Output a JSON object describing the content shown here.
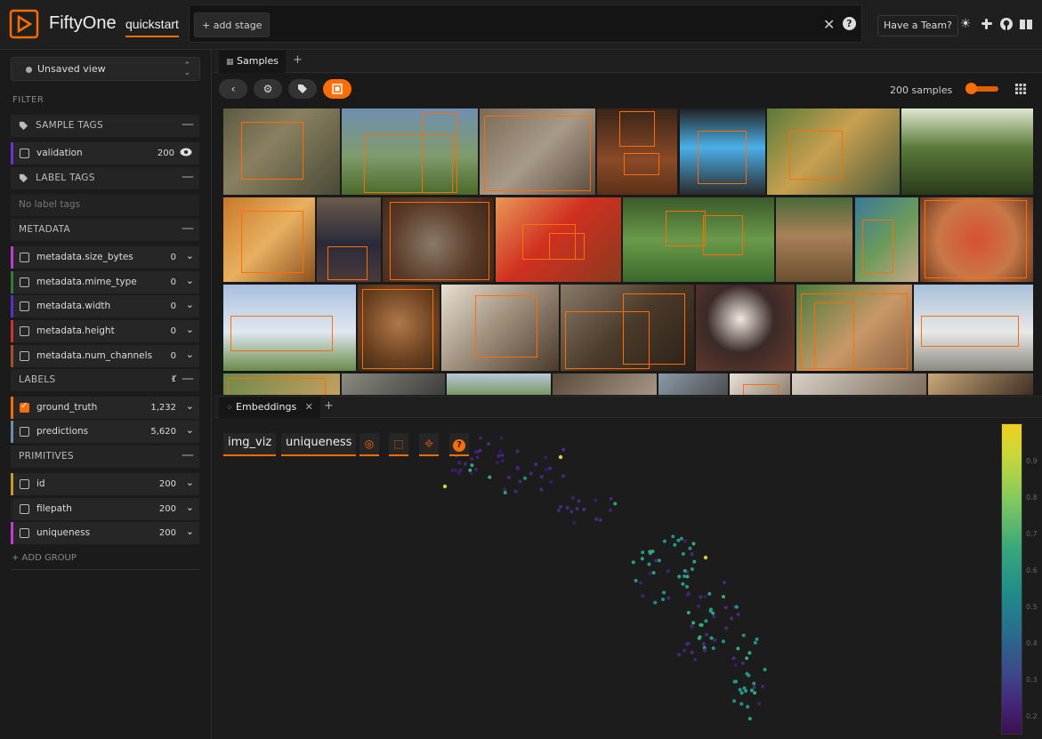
{
  "app": {
    "brand": "FiftyOne",
    "dataset": "quickstart"
  },
  "header": {
    "add_stage": "+ add stage",
    "team_button": "Have a Team?"
  },
  "sidebar": {
    "view_select": "Unsaved view",
    "filter_title": "FILTER",
    "sample_tags_title": "SAMPLE TAGS",
    "label_tags_title": "LABEL TAGS",
    "no_label_tags": "No label tags",
    "metadata_title": "METADATA",
    "labels_title": "LABELS",
    "labels_selected": "1",
    "primitives_title": "PRIMITIVES",
    "add_group": "+ ADD GROUP",
    "sample_tags": [
      {
        "name": "validation",
        "count": "200",
        "color": "#6b2fd4"
      }
    ],
    "metadata": [
      {
        "name": "metadata.size_bytes",
        "count": "0",
        "color": "#c23ad1"
      },
      {
        "name": "metadata.mime_type",
        "count": "0",
        "color": "#2e7d32"
      },
      {
        "name": "metadata.width",
        "count": "0",
        "color": "#5a2fc4"
      },
      {
        "name": "metadata.height",
        "count": "0",
        "color": "#d32f2f"
      },
      {
        "name": "metadata.num_channels",
        "count": "0",
        "color": "#a0522d"
      }
    ],
    "labels": [
      {
        "name": "ground_truth",
        "count": "1,232",
        "color": "#ff6d04",
        "checked": true
      },
      {
        "name": "predictions",
        "count": "5,620",
        "color": "#6b8eaf",
        "checked": false
      }
    ],
    "primitives": [
      {
        "name": "id",
        "count": "200",
        "color": "#c79a2a"
      },
      {
        "name": "filepath",
        "count": "200",
        "color": "#222222"
      },
      {
        "name": "uniqueness",
        "count": "200",
        "color": "#c23ad1"
      }
    ]
  },
  "samples_panel": {
    "tab_label": "Samples",
    "sample_count": "200 samples"
  },
  "embeddings_panel": {
    "tab_label": "Embeddings",
    "brain_key": "img_viz",
    "color_by": "uniqueness"
  },
  "colorbar": {
    "ticks": [
      "0.9",
      "0.8",
      "0.7",
      "0.6",
      "0.5",
      "0.4",
      "0.3",
      "0.2"
    ]
  },
  "colors": {
    "accent": "#ff6d04",
    "background": "#1a1a1a"
  }
}
